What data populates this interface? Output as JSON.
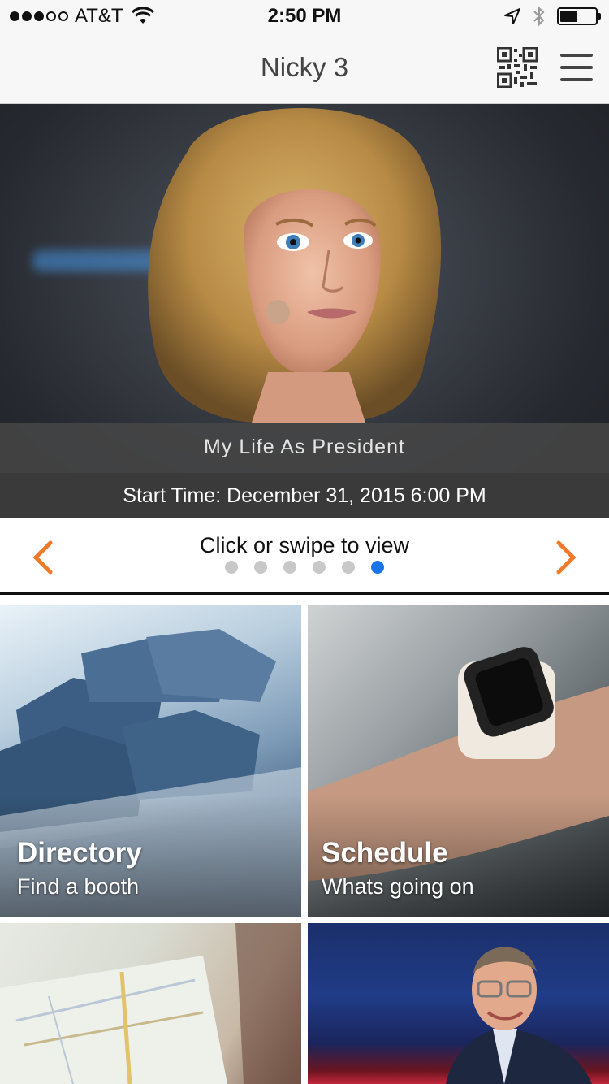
{
  "status_bar": {
    "carrier": "AT&T",
    "time": "2:50 PM",
    "signal_bars_filled": 3,
    "signal_bars_total": 5,
    "battery_level": 0.5,
    "icons": [
      "wifi-icon",
      "location-arrow-icon",
      "bluetooth-icon",
      "battery-icon"
    ]
  },
  "nav": {
    "title": "Nicky 3",
    "icons": [
      "qr-code-icon",
      "hamburger-menu-icon"
    ]
  },
  "hero": {
    "title": "My Life As President",
    "start_time": "Start Time: December 31, 2015 6:00 PM"
  },
  "pager": {
    "hint": "Click or swipe to view",
    "total_pages": 6,
    "active_page": 6,
    "colors": {
      "arrow": "#f07a2a",
      "active_dot": "#1a73e8",
      "inactive_dot": "#c8c8c8"
    }
  },
  "tiles": [
    {
      "title": "Directory",
      "subtitle": "Find a booth"
    },
    {
      "title": "Schedule",
      "subtitle": "Whats going on"
    },
    {
      "title": "",
      "subtitle": ""
    },
    {
      "title": "",
      "subtitle": ""
    }
  ]
}
